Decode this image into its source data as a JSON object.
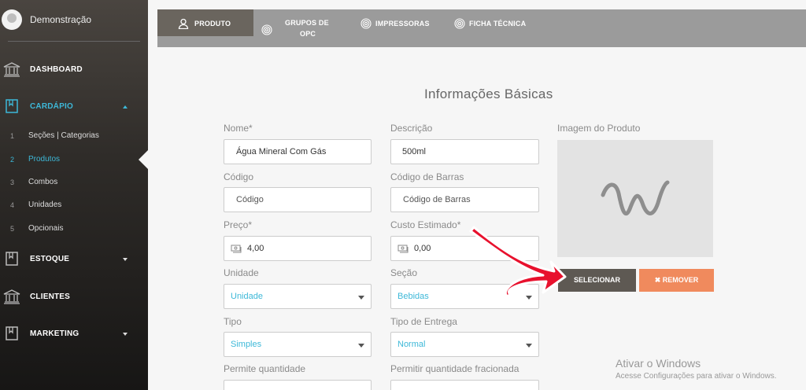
{
  "sidebar": {
    "user_name": "Demonstração",
    "items": [
      {
        "label": "DASHBOARD",
        "icon": "bank-icon"
      },
      {
        "label": "CARDÁPIO",
        "icon": "book-icon"
      },
      {
        "label": "ESTOQUE",
        "icon": "book-icon"
      },
      {
        "label": "CLIENTES",
        "icon": "bank-icon"
      },
      {
        "label": "MARKETING",
        "icon": "book-icon"
      }
    ],
    "sub_items": [
      {
        "num": "1",
        "label": "Seções | Categorias"
      },
      {
        "num": "2",
        "label": "Produtos"
      },
      {
        "num": "3",
        "label": "Combos"
      },
      {
        "num": "4",
        "label": "Unidades"
      },
      {
        "num": "5",
        "label": "Opcionais"
      }
    ]
  },
  "tabs": [
    {
      "label": "PRODUTO",
      "icon": "user-icon"
    },
    {
      "label_line1": "GRUPOS DE",
      "label_line2": "OPC",
      "icon": "fingerprint-icon"
    },
    {
      "label": "IMPRESSORAS",
      "icon": "fingerprint-icon"
    },
    {
      "label": "FICHA TÉCNICA",
      "icon": "fingerprint-icon"
    }
  ],
  "form": {
    "title": "Informações Básicas",
    "nome_label": "Nome*",
    "nome_value": "Água Mineral Com Gás",
    "descricao_label": "Descrição",
    "descricao_value": "500ml",
    "codigo_label": "Código",
    "codigo_value": "Código",
    "codigo_barras_label": "Código de Barras",
    "codigo_barras_value": "Código de Barras",
    "preco_label": "Preço*",
    "preco_value": "4,00",
    "custo_label": "Custo Estimado*",
    "custo_value": "0,00",
    "unidade_label": "Unidade",
    "unidade_value": "Unidade",
    "secao_label": "Seção",
    "secao_value": "Bebidas",
    "tipo_label": "Tipo",
    "tipo_value": "Simples",
    "tipo_entrega_label": "Tipo de Entrega",
    "tipo_entrega_value": "Normal",
    "permite_qtd_label": "Permite quantidade",
    "permite_qtd_frac_label": "Permitir quantidade fracionada",
    "imagem_label": "Imagem do Produto",
    "selecionar_label": "SELECIONAR",
    "remover_label": "✖ REMOVER"
  },
  "windows_watermark": {
    "title": "Ativar o Windows",
    "subtitle": "Acesse Configurações para ativar o Windows."
  },
  "colors": {
    "accent": "#3db8d8",
    "sidebar_bg": "#2f2c29",
    "tab_bar": "#9b9b9b",
    "tab_active": "#6a655e",
    "button_select": "#5e5953",
    "button_remove": "#f08a5d",
    "annotation_arrow": "#e8112d"
  }
}
